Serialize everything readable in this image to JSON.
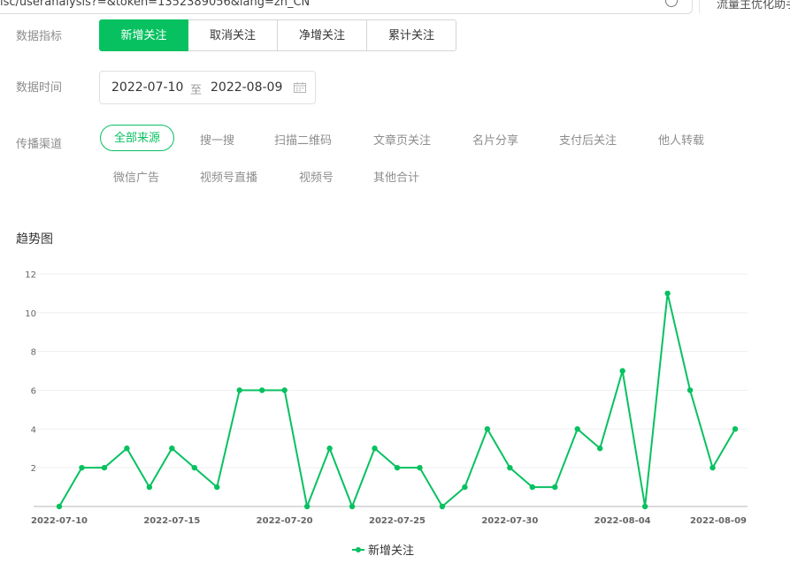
{
  "browser": {
    "url": "isc/useranalysis?=&token=1352389056&lang=zh_CN",
    "tab_title": "流量主优化助手"
  },
  "filters": {
    "metric_label": "数据指标",
    "metric_buttons": [
      "新增关注",
      "取消关注",
      "净增关注",
      "累计关注"
    ],
    "metric_active": "新增关注",
    "time_label": "数据时间",
    "date_start": "2022-07-10",
    "date_sep": "至",
    "date_end": "2022-08-09",
    "channel_label": "传播渠道",
    "channels_row1": [
      "全部来源",
      "搜一搜",
      "扫描二维码",
      "文章页关注",
      "名片分享",
      "支付后关注",
      "他人转载"
    ],
    "channels_row2": [
      "微信广告",
      "视频号直播",
      "视频号",
      "其他合计"
    ],
    "channel_active": "全部来源"
  },
  "trend": {
    "title": "趋势图"
  },
  "colors": {
    "accent": "#07c160"
  },
  "chart_data": {
    "type": "line",
    "x": [
      "2022-07-10",
      "2022-07-11",
      "2022-07-12",
      "2022-07-13",
      "2022-07-14",
      "2022-07-15",
      "2022-07-16",
      "2022-07-17",
      "2022-07-18",
      "2022-07-19",
      "2022-07-20",
      "2022-07-21",
      "2022-07-22",
      "2022-07-23",
      "2022-07-24",
      "2022-07-25",
      "2022-07-26",
      "2022-07-27",
      "2022-07-28",
      "2022-07-29",
      "2022-07-30",
      "2022-07-31",
      "2022-08-01",
      "2022-08-02",
      "2022-08-03",
      "2022-08-04",
      "2022-08-05",
      "2022-08-06",
      "2022-08-07",
      "2022-08-08",
      "2022-08-09"
    ],
    "x_ticks": [
      "2022-07-10",
      "2022-07-15",
      "2022-07-20",
      "2022-07-25",
      "2022-07-30",
      "2022-08-04",
      "2022-08-09"
    ],
    "y_ticks": [
      2,
      4,
      6,
      8,
      10,
      12
    ],
    "ylim": [
      0,
      12
    ],
    "series": [
      {
        "name": "新增关注",
        "values": [
          0,
          2,
          2,
          3,
          1,
          3,
          2,
          1,
          6,
          6,
          6,
          0,
          3,
          0,
          3,
          2,
          2,
          0,
          1,
          4,
          2,
          1,
          1,
          4,
          3,
          7,
          0,
          11,
          6,
          2,
          4
        ]
      }
    ],
    "grid": true,
    "legend": "bottom-center"
  }
}
